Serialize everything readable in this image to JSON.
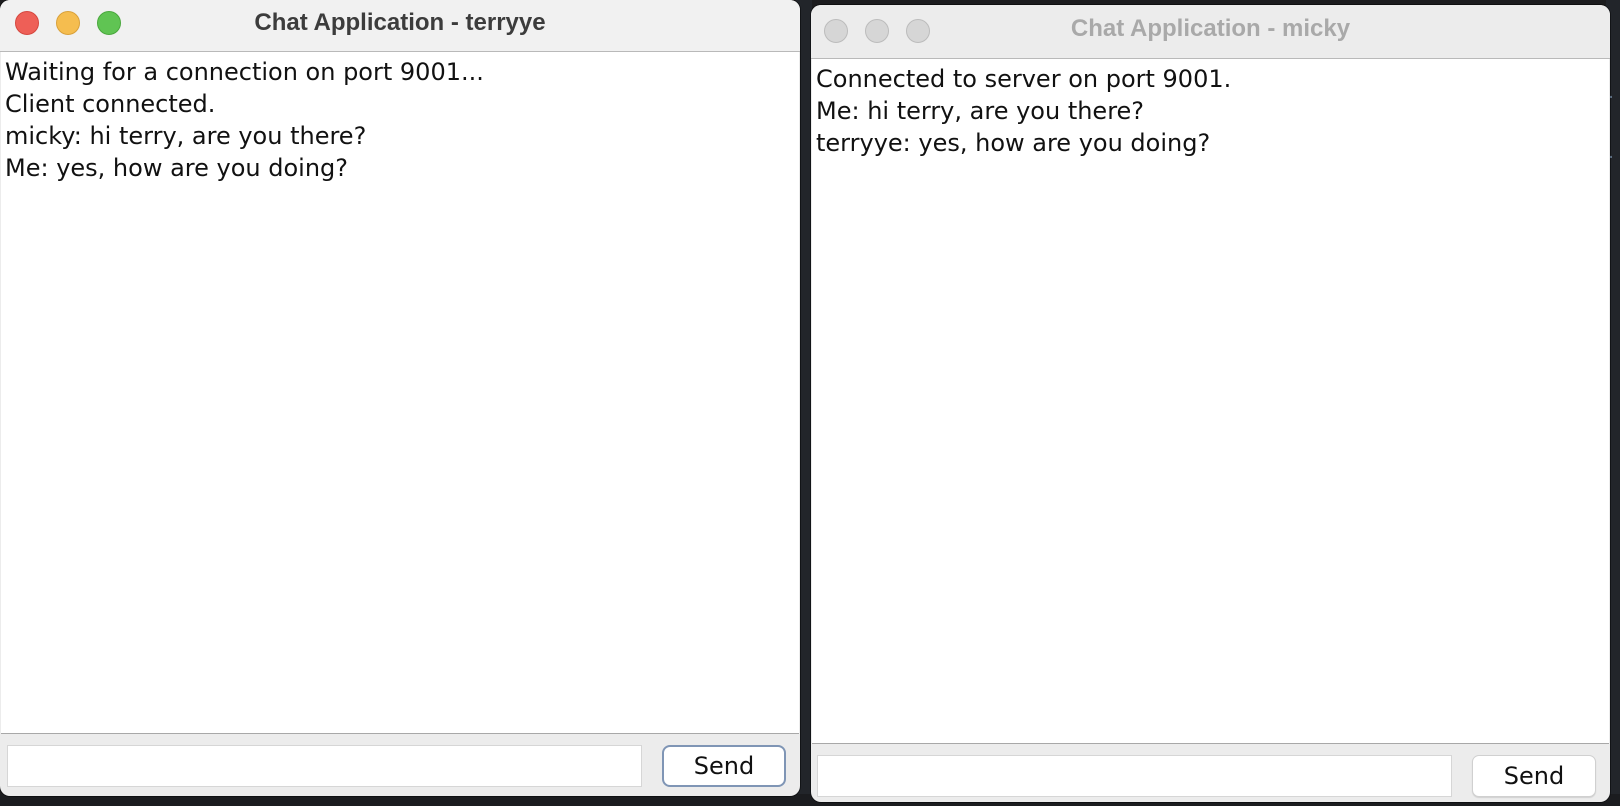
{
  "windows": {
    "server": {
      "title": "Chat Application - terryye",
      "messages": [
        "Waiting for a connection on port 9001...",
        "Client connected.",
        "micky: hi terry, are you there?",
        "Me: yes, how are you doing?"
      ],
      "input_value": "",
      "send_label": "Send"
    },
    "client": {
      "title": "Chat Application - micky",
      "messages": [
        "Connected to server on port 9001.",
        "Me: hi terry, are you there?",
        "terryye: yes, how are you doing?"
      ],
      "input_value": "",
      "send_label": "Send"
    }
  },
  "colors": {
    "close": "#ee5f57",
    "minimize": "#f5bd4f",
    "zoom": "#60c453",
    "inactive_light": "#d6d6d6"
  }
}
